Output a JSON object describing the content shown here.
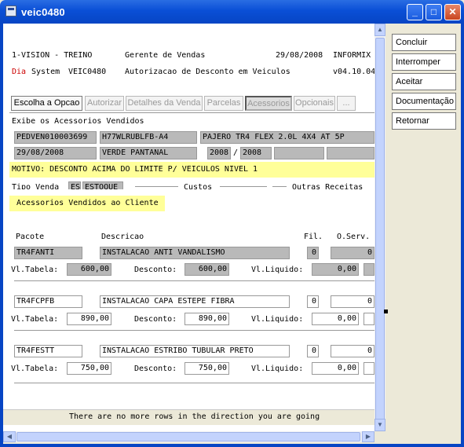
{
  "window": {
    "title": "veic0480"
  },
  "header": {
    "company": "1-VISION - TREINO",
    "role": "Gerente de Vendas",
    "date": "29/08/2008",
    "db": "INFORMIX",
    "dia_label": "Dia",
    "system_label": "System",
    "program": "VEIC0480",
    "description": "Autorizacao de Desconto em Veiculos",
    "version": "v04.10.04"
  },
  "tabs": [
    {
      "label": "Escolha a Opcao"
    },
    {
      "label": "Autorizar"
    },
    {
      "label": "Detalhes da Venda"
    },
    {
      "label": "Parcelas"
    },
    {
      "label": "Acessorios"
    },
    {
      "label": "Opcionais"
    },
    {
      "label": "..."
    }
  ],
  "subtitle": "Exibe os Acessorios Vendidos",
  "order": {
    "code": "PEDVEN010003699",
    "chassis": "H77WLRUBLFB-A4",
    "model": "PAJERO TR4 FLEX 2.0L 4X4 AT 5P",
    "date": "29/08/2008",
    "color": "VERDE PANTANAL",
    "year_fab": "2008",
    "year_sep": "/",
    "year_model": "2008"
  },
  "motivo": "MOTIVO: DESCONTO ACIMA DO LIMITE P/ VEICULOS NIVEL 1",
  "partial_row": {
    "tipo_venda_label": "Tipo Venda",
    "tipo_venda_code": "ES",
    "tipo_venda_value": "ESTOQUE",
    "custos_label": "Custos",
    "outras_label": "Outras Receitas"
  },
  "section_title": "Acessorios Vendidos ao Cliente",
  "columns": {
    "pacote": "Pacote",
    "descricao": "Descricao",
    "fil": "Fil.",
    "oserv": "O.Serv."
  },
  "labels": {
    "vl_tabela": "Vl.Tabela:",
    "desconto": "Desconto:",
    "vl_liquido": "Vl.Liquido:"
  },
  "items": [
    {
      "pacote": "TR4FANTI",
      "descricao": "INSTALACAO ANTI VANDALISMO",
      "fil": "0",
      "oserv": "0",
      "vl_tabela": "600,00",
      "desconto": "600,00",
      "vl_liquido": "0,00"
    },
    {
      "pacote": "TR4FCPFB",
      "descricao": "INSTALACAO CAPA ESTEPE FIBRA",
      "fil": "0",
      "oserv": "0",
      "vl_tabela": "890,00",
      "desconto": "890,00",
      "vl_liquido": "0,00"
    },
    {
      "pacote": "TR4FESTT",
      "descricao": "INSTALACAO ESTRIBO TUBULAR PRETO",
      "fil": "0",
      "oserv": "0",
      "vl_tabela": "750,00",
      "desconto": "750,00",
      "vl_liquido": "0,00"
    }
  ],
  "status_message": "There are no more rows in the direction you are going",
  "side_buttons": [
    {
      "label": "Concluir"
    },
    {
      "label": "Interromper"
    },
    {
      "label": "Aceitar"
    },
    {
      "label": "Documentação"
    },
    {
      "label": "Retornar"
    }
  ],
  "colors": {
    "title_bar": "#0a4fd6",
    "highlight": "#ffff99",
    "disabled_field": "#b9b9b9",
    "red_text": "#cc0000"
  }
}
